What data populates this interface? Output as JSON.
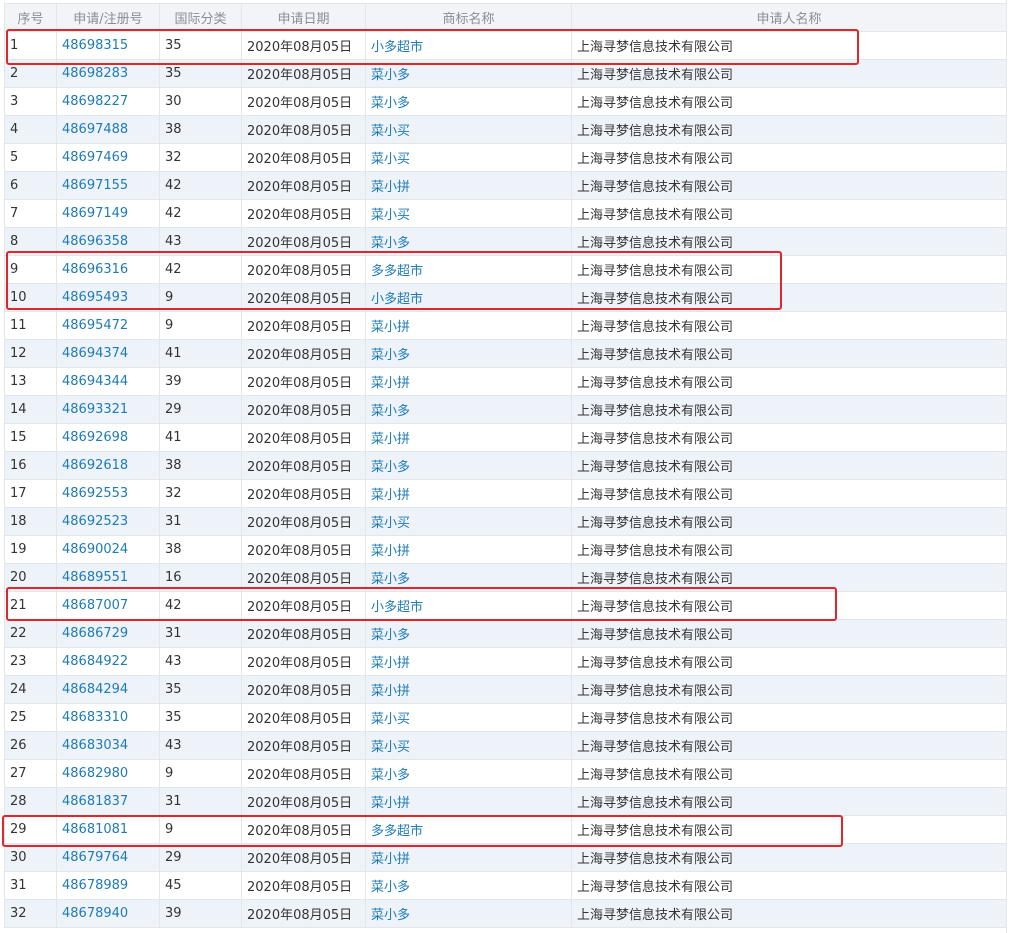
{
  "table": {
    "headers": [
      "序号",
      "申请/注册号",
      "国际分类",
      "申请日期",
      "商标名称",
      "申请人名称"
    ],
    "rows": [
      {
        "no": "1",
        "reg": "48698315",
        "cls": "35",
        "date": "2020年08月05日",
        "name": "小多超市",
        "applicant": "上海寻梦信息技术有限公司"
      },
      {
        "no": "2",
        "reg": "48698283",
        "cls": "35",
        "date": "2020年08月05日",
        "name": "菜小多",
        "applicant": "上海寻梦信息技术有限公司"
      },
      {
        "no": "3",
        "reg": "48698227",
        "cls": "30",
        "date": "2020年08月05日",
        "name": "菜小多",
        "applicant": "上海寻梦信息技术有限公司"
      },
      {
        "no": "4",
        "reg": "48697488",
        "cls": "38",
        "date": "2020年08月05日",
        "name": "菜小买",
        "applicant": "上海寻梦信息技术有限公司"
      },
      {
        "no": "5",
        "reg": "48697469",
        "cls": "32",
        "date": "2020年08月05日",
        "name": "菜小买",
        "applicant": "上海寻梦信息技术有限公司"
      },
      {
        "no": "6",
        "reg": "48697155",
        "cls": "42",
        "date": "2020年08月05日",
        "name": "菜小拼",
        "applicant": "上海寻梦信息技术有限公司"
      },
      {
        "no": "7",
        "reg": "48697149",
        "cls": "42",
        "date": "2020年08月05日",
        "name": "菜小买",
        "applicant": "上海寻梦信息技术有限公司"
      },
      {
        "no": "8",
        "reg": "48696358",
        "cls": "43",
        "date": "2020年08月05日",
        "name": "菜小多",
        "applicant": "上海寻梦信息技术有限公司"
      },
      {
        "no": "9",
        "reg": "48696316",
        "cls": "42",
        "date": "2020年08月05日",
        "name": "多多超市",
        "applicant": "上海寻梦信息技术有限公司"
      },
      {
        "no": "10",
        "reg": "48695493",
        "cls": "9",
        "date": "2020年08月05日",
        "name": "小多超市",
        "applicant": "上海寻梦信息技术有限公司"
      },
      {
        "no": "11",
        "reg": "48695472",
        "cls": "9",
        "date": "2020年08月05日",
        "name": "菜小拼",
        "applicant": "上海寻梦信息技术有限公司"
      },
      {
        "no": "12",
        "reg": "48694374",
        "cls": "41",
        "date": "2020年08月05日",
        "name": "菜小多",
        "applicant": "上海寻梦信息技术有限公司"
      },
      {
        "no": "13",
        "reg": "48694344",
        "cls": "39",
        "date": "2020年08月05日",
        "name": "菜小拼",
        "applicant": "上海寻梦信息技术有限公司"
      },
      {
        "no": "14",
        "reg": "48693321",
        "cls": "29",
        "date": "2020年08月05日",
        "name": "菜小多",
        "applicant": "上海寻梦信息技术有限公司"
      },
      {
        "no": "15",
        "reg": "48692698",
        "cls": "41",
        "date": "2020年08月05日",
        "name": "菜小拼",
        "applicant": "上海寻梦信息技术有限公司"
      },
      {
        "no": "16",
        "reg": "48692618",
        "cls": "38",
        "date": "2020年08月05日",
        "name": "菜小多",
        "applicant": "上海寻梦信息技术有限公司"
      },
      {
        "no": "17",
        "reg": "48692553",
        "cls": "32",
        "date": "2020年08月05日",
        "name": "菜小拼",
        "applicant": "上海寻梦信息技术有限公司"
      },
      {
        "no": "18",
        "reg": "48692523",
        "cls": "31",
        "date": "2020年08月05日",
        "name": "菜小买",
        "applicant": "上海寻梦信息技术有限公司"
      },
      {
        "no": "19",
        "reg": "48690024",
        "cls": "38",
        "date": "2020年08月05日",
        "name": "菜小拼",
        "applicant": "上海寻梦信息技术有限公司"
      },
      {
        "no": "20",
        "reg": "48689551",
        "cls": "16",
        "date": "2020年08月05日",
        "name": "菜小多",
        "applicant": "上海寻梦信息技术有限公司"
      },
      {
        "no": "21",
        "reg": "48687007",
        "cls": "42",
        "date": "2020年08月05日",
        "name": "小多超市",
        "applicant": "上海寻梦信息技术有限公司"
      },
      {
        "no": "22",
        "reg": "48686729",
        "cls": "31",
        "date": "2020年08月05日",
        "name": "菜小多",
        "applicant": "上海寻梦信息技术有限公司"
      },
      {
        "no": "23",
        "reg": "48684922",
        "cls": "43",
        "date": "2020年08月05日",
        "name": "菜小拼",
        "applicant": "上海寻梦信息技术有限公司"
      },
      {
        "no": "24",
        "reg": "48684294",
        "cls": "35",
        "date": "2020年08月05日",
        "name": "菜小拼",
        "applicant": "上海寻梦信息技术有限公司"
      },
      {
        "no": "25",
        "reg": "48683310",
        "cls": "35",
        "date": "2020年08月05日",
        "name": "菜小买",
        "applicant": "上海寻梦信息技术有限公司"
      },
      {
        "no": "26",
        "reg": "48683034",
        "cls": "43",
        "date": "2020年08月05日",
        "name": "菜小买",
        "applicant": "上海寻梦信息技术有限公司"
      },
      {
        "no": "27",
        "reg": "48682980",
        "cls": "9",
        "date": "2020年08月05日",
        "name": "菜小多",
        "applicant": "上海寻梦信息技术有限公司"
      },
      {
        "no": "28",
        "reg": "48681837",
        "cls": "31",
        "date": "2020年08月05日",
        "name": "菜小拼",
        "applicant": "上海寻梦信息技术有限公司"
      },
      {
        "no": "29",
        "reg": "48681081",
        "cls": "9",
        "date": "2020年08月05日",
        "name": "多多超市",
        "applicant": "上海寻梦信息技术有限公司"
      },
      {
        "no": "30",
        "reg": "48679764",
        "cls": "29",
        "date": "2020年08月05日",
        "name": "菜小拼",
        "applicant": "上海寻梦信息技术有限公司"
      },
      {
        "no": "31",
        "reg": "48678989",
        "cls": "45",
        "date": "2020年08月05日",
        "name": "菜小多",
        "applicant": "上海寻梦信息技术有限公司"
      },
      {
        "no": "32",
        "reg": "48678940",
        "cls": "39",
        "date": "2020年08月05日",
        "name": "菜小多",
        "applicant": "上海寻梦信息技术有限公司"
      }
    ]
  },
  "colors": {
    "link": "#1e7bb8",
    "highlight_border": "#e0262a",
    "header_bg": "#f2f4f7",
    "stripe_bg": "#eef3f9"
  }
}
